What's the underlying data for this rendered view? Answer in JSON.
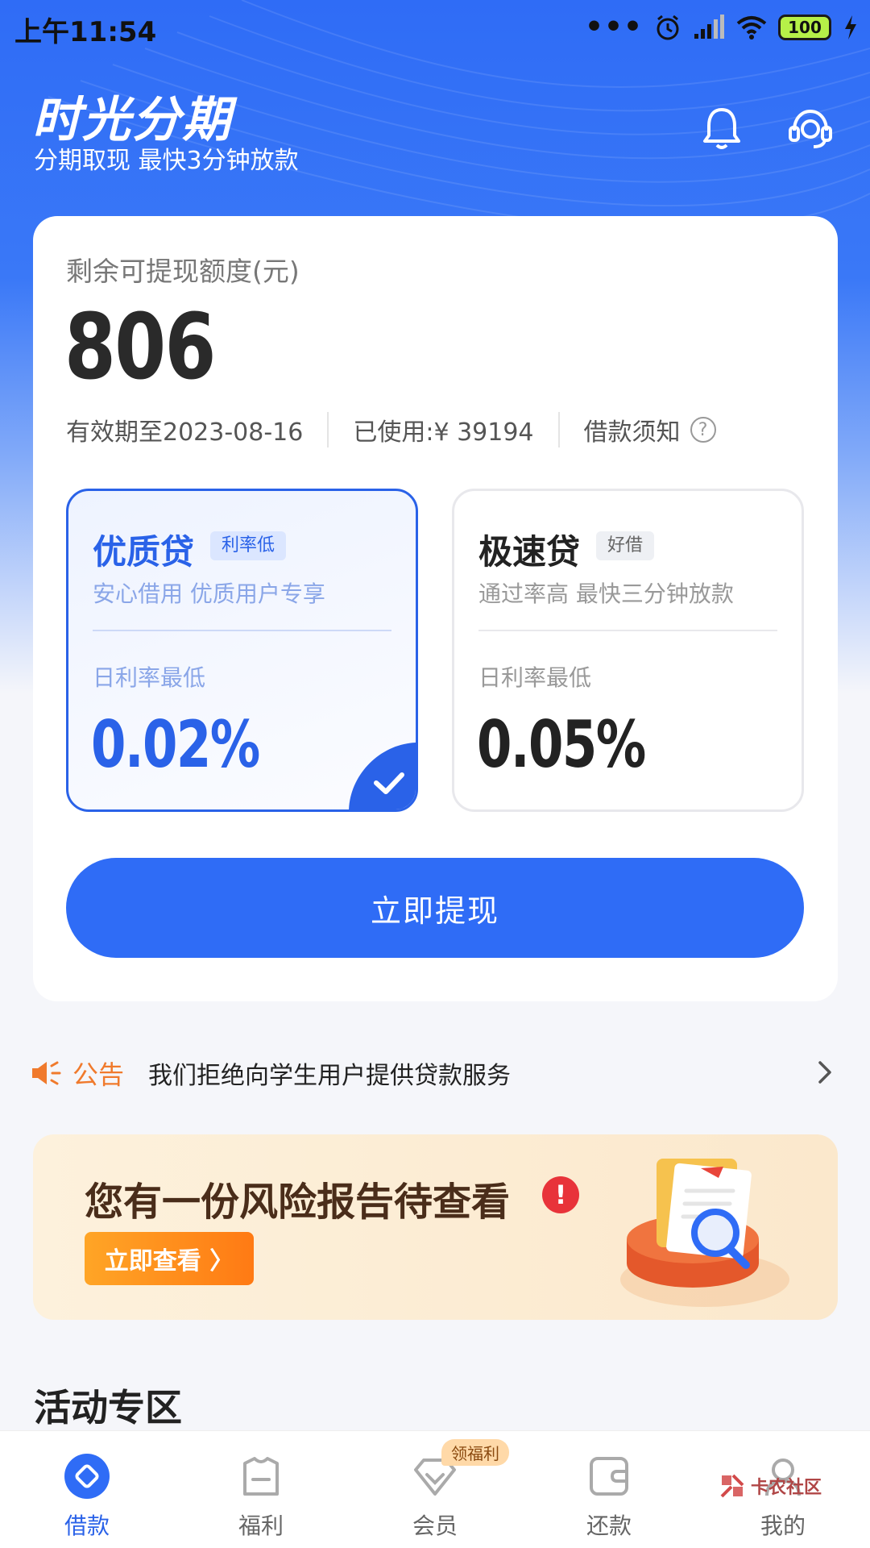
{
  "status_bar": {
    "time": "上午11:54",
    "dots": "•••",
    "battery": "100"
  },
  "header": {
    "title": "时光分期",
    "subtitle": "分期取现 最快3分钟放款"
  },
  "quota": {
    "label": "剩余可提现额度(元)",
    "value": "806",
    "valid_until": "有效期至2023-08-16",
    "used": "已使用:¥ 39194",
    "notice_link": "借款须知",
    "help_glyph": "?"
  },
  "loan_options": [
    {
      "name": "优质贷",
      "tag": "利率低",
      "desc": "安心借用 优质用户专享",
      "rate_label": "日利率最低",
      "rate": "0.02%",
      "selected": true
    },
    {
      "name": "极速贷",
      "tag": "好借",
      "desc": "通过率高 最快三分钟放款",
      "rate_label": "日利率最低",
      "rate": "0.05%",
      "selected": false
    }
  ],
  "cta": {
    "label": "立即提现"
  },
  "notice": {
    "label": "公告",
    "text": "我们拒绝向学生用户提供贷款服务"
  },
  "risk_banner": {
    "title": "您有一份风险报告待查看",
    "warn_glyph": "!",
    "button": "立即查看 〉"
  },
  "activity": {
    "title": "活动专区"
  },
  "tabbar": {
    "items": [
      {
        "label": "借款",
        "icon": "loan-icon",
        "active": true
      },
      {
        "label": "福利",
        "icon": "gift-icon",
        "active": false
      },
      {
        "label": "会员",
        "icon": "diamond-icon",
        "active": false,
        "badge": "领福利"
      },
      {
        "label": "还款",
        "icon": "wallet-icon",
        "active": false
      },
      {
        "label": "我的",
        "icon": "profile-icon",
        "active": false
      }
    ]
  },
  "watermark": {
    "text": "卡农社区"
  },
  "colors": {
    "primary": "#2f6cf6",
    "accent_orange": "#f07a2c",
    "warning_red": "#e8333a"
  }
}
